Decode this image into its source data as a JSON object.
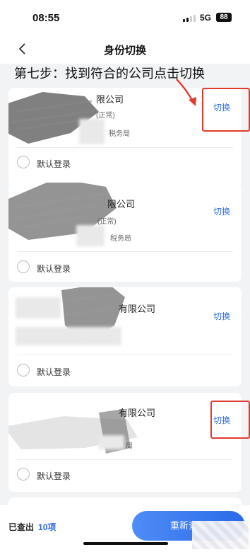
{
  "status_bar": {
    "time": "08:55",
    "network": "5G",
    "battery": "88"
  },
  "nav": {
    "title": "身份切换"
  },
  "instruction": "第七步：找到符合的公司点击切换",
  "cards": [
    {
      "company": "限公司",
      "type": "(正常)",
      "tax_office": "税务局",
      "switch_label": "切换",
      "default_label": "默认登录"
    },
    {
      "company": "限公司",
      "type": "(正常)",
      "tax_office": "税务局",
      "switch_label": "切换",
      "default_label": "默认登录"
    },
    {
      "company": "有限公司",
      "switch_label": "切换",
      "default_label": "默认登录"
    },
    {
      "company": "有限公司",
      "tax_office": "局",
      "switch_label": "切换",
      "default_label": "默认登录"
    }
  ],
  "footer": {
    "found_label": "已查出",
    "found_count": "10项",
    "requery_label": "重新查询"
  },
  "colors": {
    "accent": "#2d6bea",
    "highlight": "#e03b2e"
  }
}
